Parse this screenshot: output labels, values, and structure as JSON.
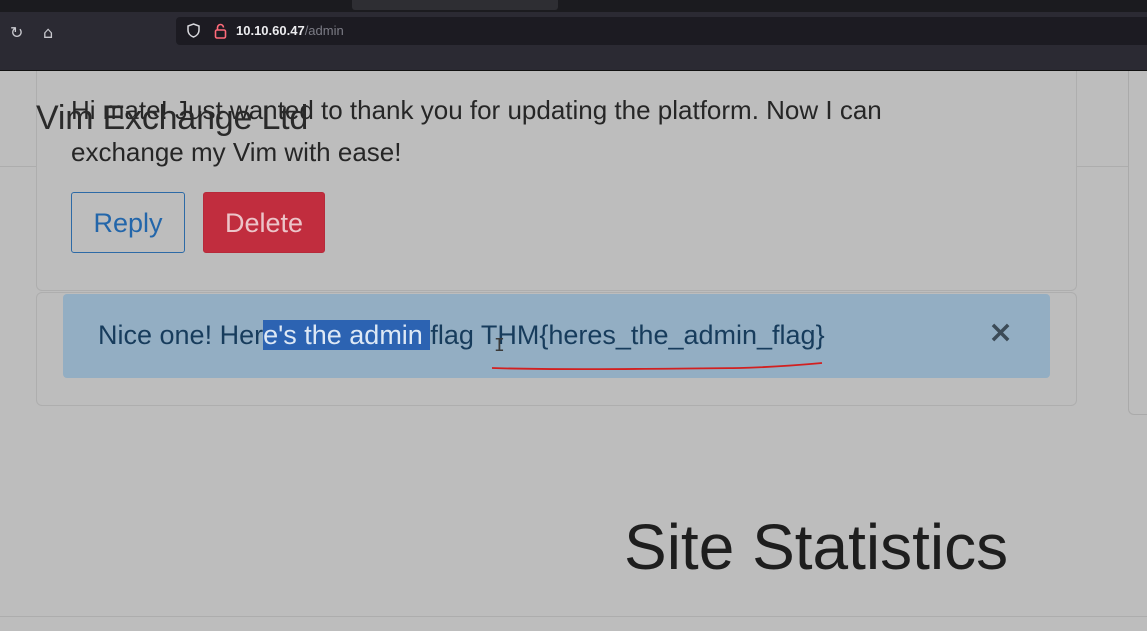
{
  "browser": {
    "url_host": "10.10.60.47",
    "url_path": "/admin",
    "icons": [
      "reload-icon",
      "home-icon",
      "shield-icon",
      "lock-icon"
    ]
  },
  "site": {
    "brand": "Vim Exchange Ltd"
  },
  "message": {
    "text": "Hi mate! Just wanted to thank you for updating the platform. Now I can exchange my Vim with ease!",
    "reply_label": "Reply",
    "delete_label": "Delete"
  },
  "alert": {
    "text_before": "Nice one! Her",
    "text_selected": "e's the admin ",
    "text_after": "flag THM{heres_the_admin_flag}",
    "close_symbol": "×"
  },
  "stats": {
    "title": "Site Statistics"
  },
  "colors": {
    "reply": "#2366aa",
    "delete": "#c12d3e",
    "alert_bg": "#93aec3",
    "selection": "#2c63b2",
    "annotation": "#d22020"
  }
}
